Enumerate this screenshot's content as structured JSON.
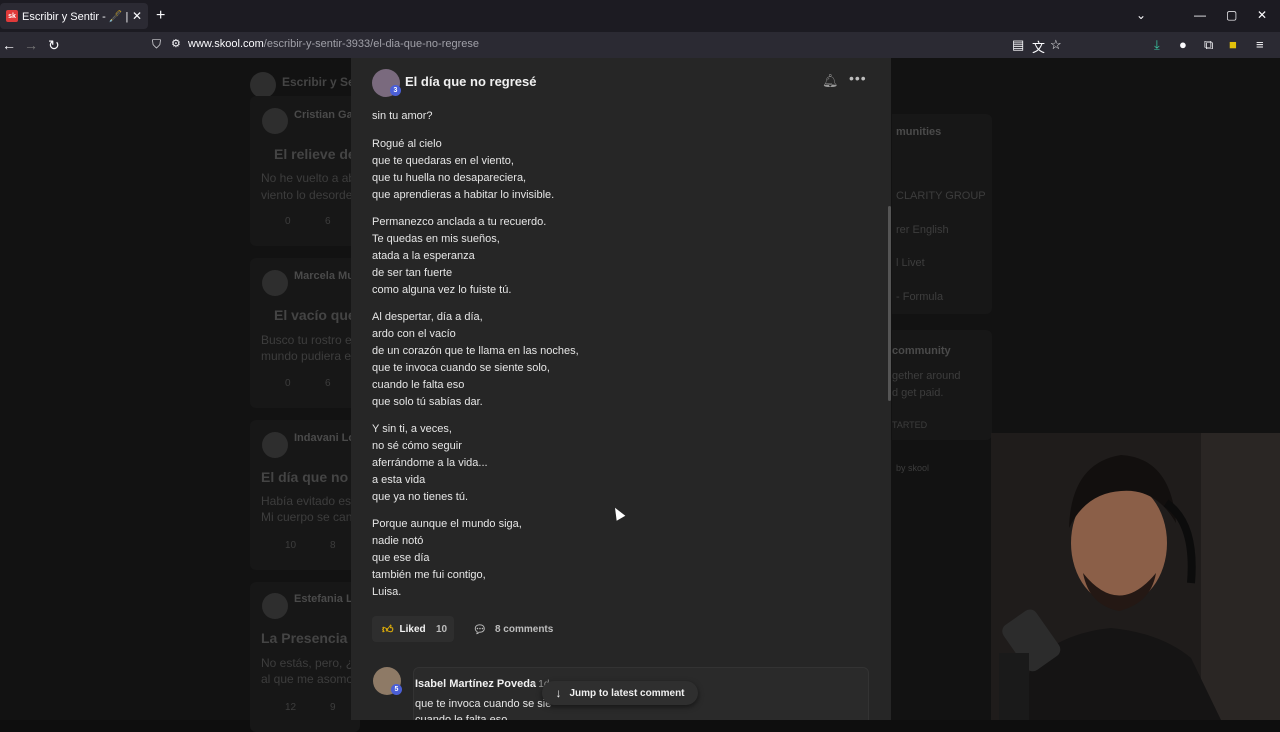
{
  "browser": {
    "tab_title": "Escribir y Sentir - 🖋️ | Dinámica",
    "tab_favicon_text": "sk",
    "url_domain": "www.skool.com",
    "url_path": "/escribir-y-sentir-3933/el-dia-que-no-regrese"
  },
  "background": {
    "group_name": "Escribir y Se",
    "posts": [
      {
        "author": "Cristian Ga",
        "title": "El relieve de",
        "excerpt1": "No he vuelto a abr",
        "excerpt2": "viento lo desorder",
        "likes": "0",
        "comments": "6"
      },
      {
        "author": "Marcela Mu",
        "title": "El vacío que",
        "excerpt1": "Busco tu rostro en",
        "excerpt2": "mundo pudiera en",
        "likes": "0",
        "comments": "6"
      },
      {
        "author": "Indavani Lo",
        "title": "El día que no r",
        "excerpt1": "Había evitado esc",
        "excerpt2": "Mi cuerpo se cans",
        "likes": "10",
        "comments": "8"
      },
      {
        "author": "Estefania Lo",
        "title": "La Presencia d",
        "excerpt1": "No estás, pero, ¿y",
        "excerpt2": "al que me asomo",
        "likes": "12",
        "comments": "9"
      }
    ],
    "sidebar": {
      "header": "munities",
      "items": [
        "CLARITY GROUP",
        "rer English",
        "l Livet",
        "- Formula"
      ],
      "community_header": "community",
      "community_text1": "gether around",
      "community_text2": "d get paid.",
      "cta": "TARTED",
      "powered": "by skool"
    }
  },
  "post": {
    "title": "El día que no regresé",
    "author_level": "3",
    "stanzas": [
      [
        "sin tu amor?"
      ],
      [
        "Rogué al cielo",
        "que te quedaras en el viento,",
        "que tu huella no desapareciera,",
        "que aprendieras a habitar lo invisible."
      ],
      [
        "Permanezco anclada a tu recuerdo.",
        "Te quedas en mis sueños,",
        "atada a la esperanza",
        "de ser tan fuerte",
        "como alguna vez lo fuiste tú."
      ],
      [
        "Al despertar, día a día,",
        "ardo con el vacío",
        "de un corazón que te llama en las noches,",
        "que te invoca cuando se siente solo,",
        "cuando le falta eso",
        "que solo tú sabías dar."
      ],
      [
        "Y sin ti, a veces,",
        "no sé cómo seguir",
        "aferrándome a la vida...",
        "a esta vida",
        "que ya no tienes tú."
      ],
      [
        "Porque aunque el mundo siga,",
        "nadie notó",
        "que ese día",
        "también me fui contigo,",
        "Luisa."
      ]
    ],
    "like_label": "Liked",
    "like_count": "10",
    "comments_label": "8 comments"
  },
  "comment": {
    "author": "Isabel Martínez Poveda",
    "time": "• 1d",
    "level": "5",
    "line1": "que te invoca cuando se sie",
    "line2": "cuando le falta eso"
  },
  "jump_label": "Jump to latest comment"
}
